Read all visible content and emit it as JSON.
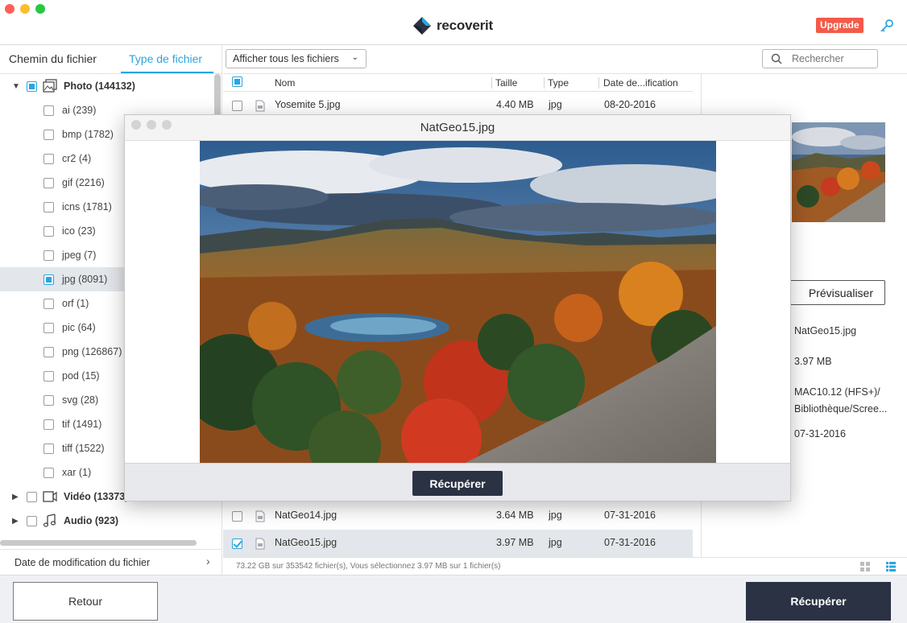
{
  "app": {
    "brand": "recoverit",
    "upgrade_label": "Upgrade"
  },
  "sidebar": {
    "tabs": [
      "Chemin du fichier",
      "Type de fichier"
    ],
    "active_tab": "Type de fichier",
    "tree": [
      {
        "label": "Photo (144132)",
        "level": 0,
        "expanded": true,
        "check": "partial",
        "icon": "photo-icon"
      },
      {
        "label": "ai (239)",
        "level": 1,
        "check": "none"
      },
      {
        "label": "bmp (1782)",
        "level": 1,
        "check": "none"
      },
      {
        "label": "cr2 (4)",
        "level": 1,
        "check": "none"
      },
      {
        "label": "gif (2216)",
        "level": 1,
        "check": "none"
      },
      {
        "label": "icns (1781)",
        "level": 1,
        "check": "none"
      },
      {
        "label": "ico (23)",
        "level": 1,
        "check": "none"
      },
      {
        "label": "jpeg (7)",
        "level": 1,
        "check": "none"
      },
      {
        "label": "jpg (8091)",
        "level": 1,
        "check": "partial",
        "selected": true
      },
      {
        "label": "orf (1)",
        "level": 1,
        "check": "none"
      },
      {
        "label": "pic (64)",
        "level": 1,
        "check": "none"
      },
      {
        "label": "png (126867)",
        "level": 1,
        "check": "none"
      },
      {
        "label": "pod (15)",
        "level": 1,
        "check": "none"
      },
      {
        "label": "svg (28)",
        "level": 1,
        "check": "none"
      },
      {
        "label": "tif (1491)",
        "level": 1,
        "check": "none"
      },
      {
        "label": "tiff (1522)",
        "level": 1,
        "check": "none"
      },
      {
        "label": "xar (1)",
        "level": 1,
        "check": "none"
      },
      {
        "label": "Vidéo (13373)",
        "level": 0,
        "expanded": false,
        "check": "none",
        "icon": "video-icon"
      },
      {
        "label": "Audio (923)",
        "level": 0,
        "expanded": false,
        "check": "none",
        "icon": "music-icon"
      }
    ],
    "footer_label": "Date de modification du fichier"
  },
  "toolbar": {
    "filter_label": "Afficher tous les fichiers",
    "search_placeholder": "Rechercher"
  },
  "file_list": {
    "columns": [
      "Nom",
      "Taille",
      "Type",
      "Date de...ification"
    ],
    "rows": [
      {
        "name": "Yosemite 5.jpg",
        "size": "4.40 MB",
        "type": "jpg",
        "date": "08-20-2016",
        "checked": false
      },
      {
        "name": "NatGeo14.jpg",
        "size": "3.64 MB",
        "type": "jpg",
        "date": "07-31-2016",
        "checked": false
      },
      {
        "name": "NatGeo15.jpg",
        "size": "3.97 MB",
        "type": "jpg",
        "date": "07-31-2016",
        "checked": true,
        "selected": true
      }
    ],
    "status": "73.22 GB sur 353542 fichier(s), Vous sélectionnez 3.97 MB sur 1 fichier(s)"
  },
  "details": {
    "preview_label": "Prévisualiser",
    "name": "NatGeo15.jpg",
    "size": "3.97 MB",
    "path_line1": "MAC10.12 (HFS+)/",
    "path_line2": "Bibliothèque/Scree...",
    "date": "07-31-2016"
  },
  "modal": {
    "title": "NatGeo15.jpg",
    "recover_label": "Récupérer"
  },
  "bottom": {
    "back_label": "Retour",
    "recover_label": "Récupérer"
  },
  "colors": {
    "accent": "#2aa5de",
    "dark_button": "#2b3244",
    "upgrade": "#f35a4a"
  }
}
